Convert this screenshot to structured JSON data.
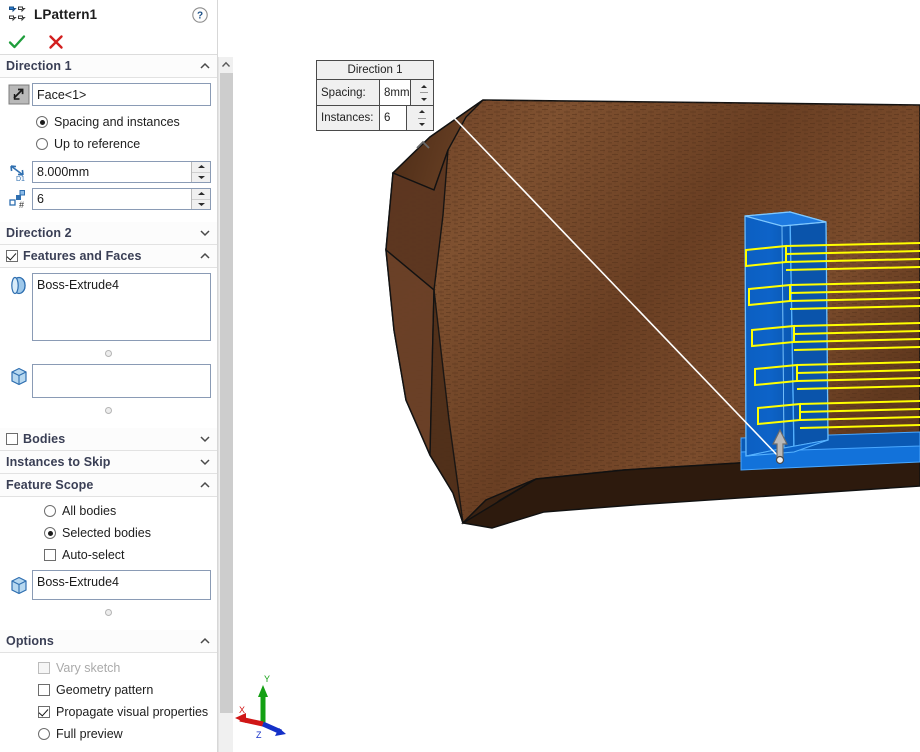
{
  "propertyManager": {
    "title": "LPattern1",
    "title_icon": "linear-pattern-icon",
    "help_icon": "help-icon",
    "accept_label": "OK",
    "accept_icon": "green-check-icon",
    "cancel_label": "Cancel",
    "cancel_icon": "red-x-icon",
    "sections": {
      "direction1": {
        "label": "Direction 1",
        "reference_value": "Face<1>",
        "reference_placeholder": "",
        "reverse_direction_icon": "reverse-direction-icon",
        "mode_options": [
          "Spacing and instances",
          "Up to reference"
        ],
        "mode_selected": "Spacing and instances",
        "spacing_icon": "spacing-d1-icon",
        "spacing_value": "8.000mm",
        "instances_icon": "number-of-instances-icon",
        "instances_value": "6"
      },
      "direction2": {
        "label": "Direction 2",
        "collapsed": true
      },
      "featuresAndFaces": {
        "label": "Features and Faces",
        "checked": true,
        "features_icon": "features-icon",
        "features_value": "Boss-Extrude4",
        "faces_icon": "solid-body-icon",
        "faces_value": ""
      },
      "bodies": {
        "label": "Bodies",
        "checked": false,
        "collapsed": true
      },
      "instancesToSkip": {
        "label": "Instances to Skip",
        "collapsed": true
      },
      "featureScope": {
        "label": "Feature Scope",
        "scope_options": [
          "All bodies",
          "Selected bodies"
        ],
        "scope_selected": "Selected bodies",
        "autoselect_label": "Auto-select",
        "autoselect_checked": false,
        "body_icon": "solid-body-icon",
        "body_value": "Boss-Extrude4"
      },
      "options": {
        "label": "Options",
        "items": [
          {
            "label": "Vary sketch",
            "type": "checkbox",
            "checked": false,
            "disabled": true
          },
          {
            "label": "Geometry pattern",
            "type": "checkbox",
            "checked": false,
            "disabled": false
          },
          {
            "label": "Propagate visual properties",
            "type": "checkbox",
            "checked": true,
            "disabled": false
          },
          {
            "label": "Full preview",
            "type": "radio",
            "checked": false,
            "disabled": false
          }
        ]
      }
    }
  },
  "callout": {
    "title": "Direction 1",
    "spacing_label": "Spacing:",
    "spacing_value": "8mm",
    "instances_label": "Instances:",
    "instances_value": "6"
  },
  "viewport": {
    "triad": {
      "x_label": "X",
      "y_label": "Y",
      "z_label": "Z"
    },
    "selection_color": "#0d63c8",
    "preview_color": "#ffff00",
    "wood_color": "#7a4a2a",
    "wood_dark_color": "#3a2212",
    "preview_instance_count": 5
  }
}
